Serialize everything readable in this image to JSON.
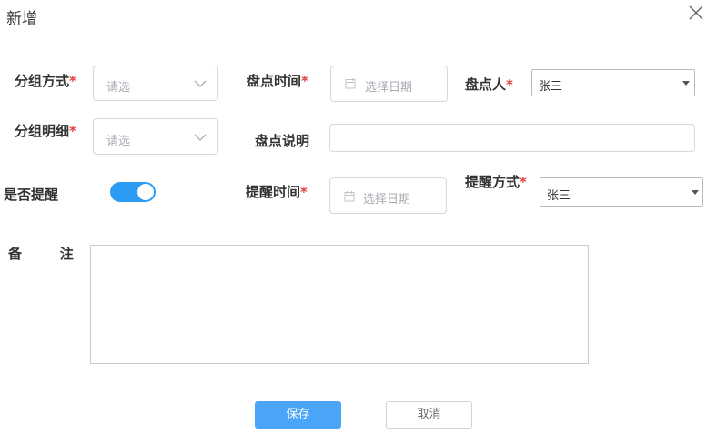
{
  "dialog": {
    "title": "新增"
  },
  "form": {
    "group_method": {
      "label": "分组方式",
      "required": "*",
      "placeholder": "请选"
    },
    "check_time": {
      "label": "盘点时间",
      "required": "*",
      "placeholder": "选择日期"
    },
    "checker": {
      "label": "盘点人",
      "required": "*",
      "value": "张三"
    },
    "group_detail": {
      "label": "分组明细",
      "required": "*",
      "placeholder": "请选"
    },
    "check_desc": {
      "label": "盘点说明",
      "value": ""
    },
    "remind": {
      "label": "是否提醒",
      "enabled": true
    },
    "remind_time": {
      "label": "提醒时间",
      "required": "*",
      "placeholder": "选择日期"
    },
    "remind_method": {
      "label": "提醒方式",
      "required": "*",
      "value": "张三"
    },
    "remark": {
      "label": "备        注",
      "value": ""
    }
  },
  "actions": {
    "save": "保存",
    "cancel": "取消"
  },
  "colors": {
    "primary": "#4aa4f8",
    "toggle_on": "#2b9bf4",
    "required": "#e04040"
  }
}
